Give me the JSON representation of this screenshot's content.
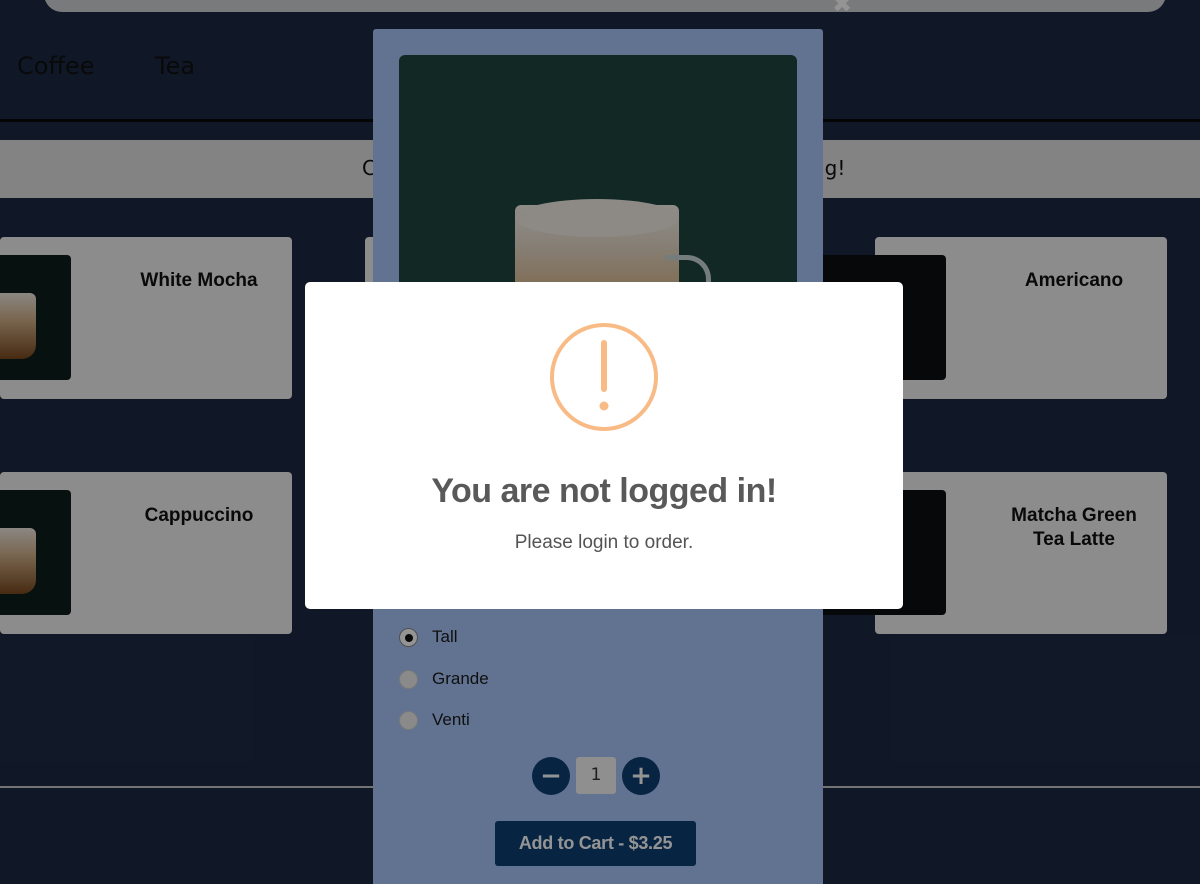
{
  "nav": {
    "tabs": [
      "Coffee",
      "Tea"
    ]
  },
  "banner": {
    "text_left": "C",
    "text_right": "ng!"
  },
  "products": {
    "items": [
      {
        "name": "White Mocha"
      },
      {
        "name": "Americano"
      },
      {
        "name": "Cappuccino"
      },
      {
        "name": "Matcha Green Tea Latte"
      }
    ]
  },
  "product_modal": {
    "sizes": [
      {
        "label": "Tall",
        "selected": true
      },
      {
        "label": "Grande",
        "selected": false
      },
      {
        "label": "Venti",
        "selected": false
      }
    ],
    "quantity": "1",
    "decrement_label": "−",
    "increment_label": "+",
    "add_to_cart_label": "Add to Cart - $3.25",
    "close_label": "✖"
  },
  "alert": {
    "icon": "warning-icon",
    "title": "You are not logged in!",
    "message": "Please login to order."
  },
  "colors": {
    "alert_accent": "#f8bb86",
    "primary_button": "#0d3f73",
    "modal_background": "#a9c6fb"
  }
}
